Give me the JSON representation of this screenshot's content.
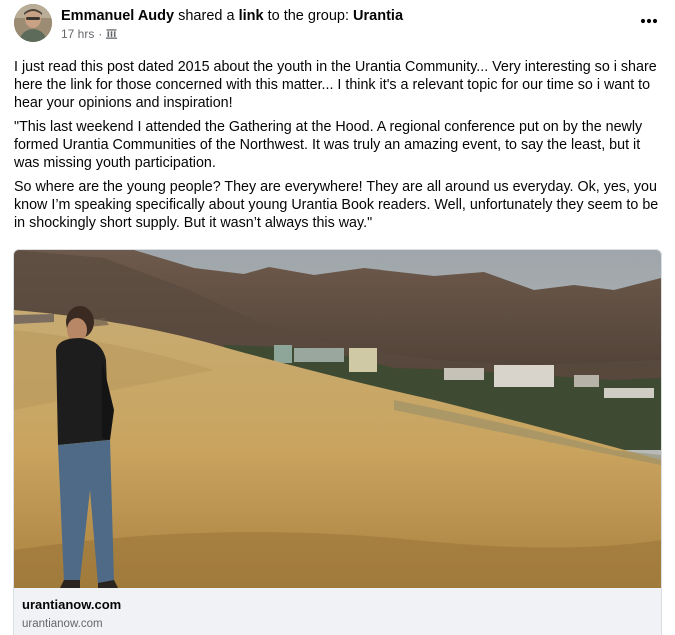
{
  "post": {
    "author": "Emmanuel Audy",
    "action_prefix": "shared a",
    "action_object": "link",
    "action_suffix": "to the group:",
    "group_name": "Urantia",
    "timestamp": "17 hrs",
    "separator": "·",
    "privacy_icon": "group-icon",
    "more_icon": "more-options-icon"
  },
  "body": {
    "paragraphs": [
      "I just read this post dated 2015 about the youth in the Urantia Community... Very interesting so i share here the link for those concerned with this matter... I think it's a relevant topic for our time so i want to hear your opinions and inspiration!",
      "\"This last weekend I attended the Gathering at the Hood. A regional conference put on by the newly formed Urantia Communities of the Northwest. It was truly an amazing event, to say the least, but it was missing youth participation.",
      "So where are the young people? They are everywhere! They are all around us everyday. Ok, yes, you know I’m speaking specifically about young Urantia Book readers. Well, unfortunately they seem to be in shockingly short supply. But it wasn’t always this way.\""
    ]
  },
  "link_preview": {
    "title": "urantianow.com",
    "domain": "urantianow.com",
    "image_subject": "young man standing on a golden grassy hillside looking at mountains and a campus"
  },
  "colors": {
    "text_primary": "#050505",
    "text_secondary": "#65676b",
    "caption_bg": "#f0f2f5",
    "border": "#dadde1"
  }
}
